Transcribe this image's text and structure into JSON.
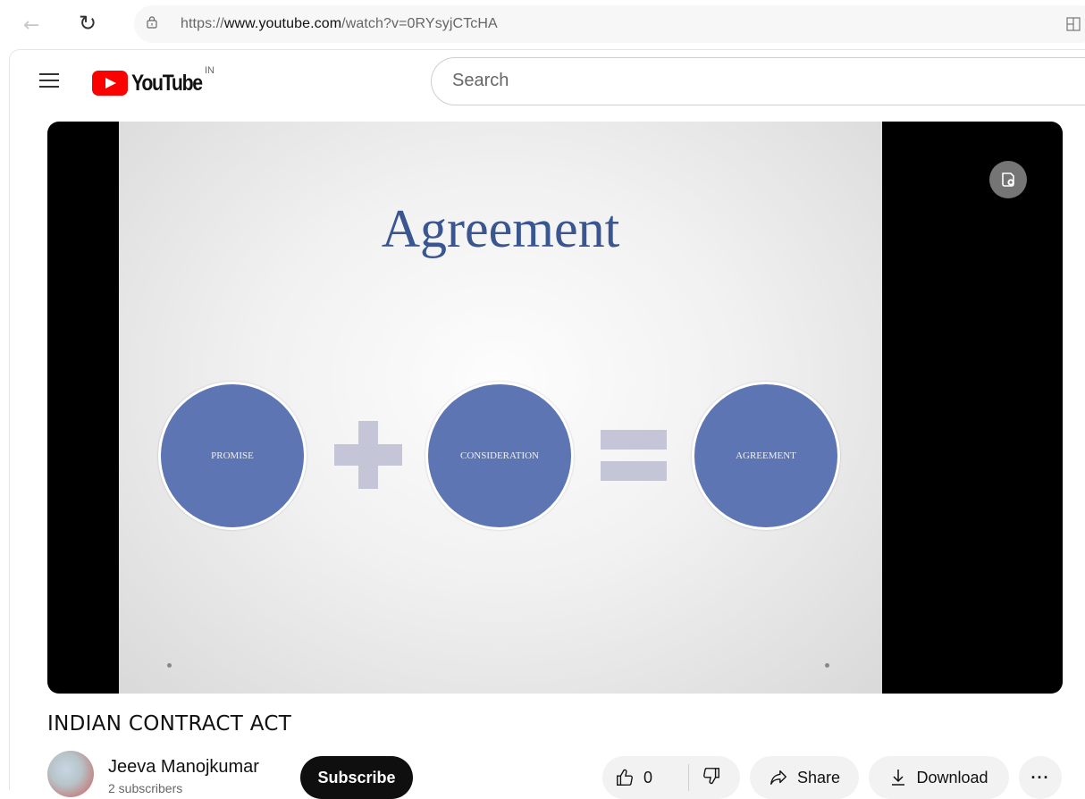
{
  "browser": {
    "url_prefix": "https://",
    "url_domain": "www.youtube.com",
    "url_path": "/watch?v=0RYsyjCTcHA",
    "back_icon": "arrow-left-icon",
    "reload_icon": "reload-icon"
  },
  "youtube": {
    "logo_text": "YouTube",
    "region": "IN",
    "search_placeholder": "Search",
    "brand_color": "#ff0000"
  },
  "video": {
    "slide_title": "Agreement",
    "circles": [
      "PROMISE",
      "CONSIDERATION",
      "AGREEMENT"
    ],
    "operators": [
      "plus",
      "equals"
    ],
    "title": "INDIAN CONTRACT ACT",
    "circle_color": "#5e75b3",
    "slide_title_color": "#3a5690"
  },
  "channel": {
    "name": "Jeeva Manojkumar",
    "subscribers": "2 subscribers",
    "subscribe_label": "Subscribe"
  },
  "actions": {
    "like_count": "0",
    "share_label": "Share",
    "download_label": "Download",
    "more_label": "···"
  }
}
